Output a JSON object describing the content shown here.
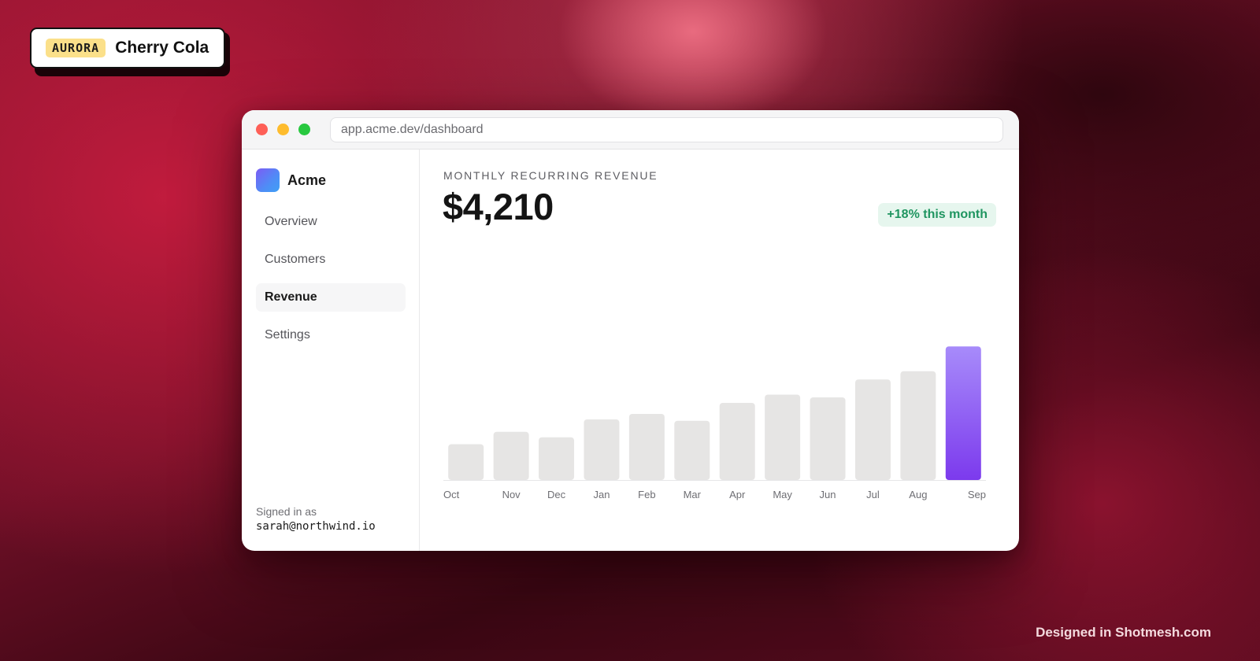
{
  "theme": {
    "badge": "AURORA",
    "name": "Cherry Cola"
  },
  "window": {
    "url": "app.acme.dev/dashboard"
  },
  "sidebar": {
    "brand": "Acme",
    "items": [
      {
        "label": "Overview",
        "active": false
      },
      {
        "label": "Customers",
        "active": false
      },
      {
        "label": "Revenue",
        "active": true
      },
      {
        "label": "Settings",
        "active": false
      }
    ],
    "signed_in_label": "Signed in as",
    "signed_in_email": "sarah@northwind.io"
  },
  "main": {
    "metric_label": "MONTHLY RECURRING REVENUE",
    "metric_value": "$4,210",
    "delta": "+18% this month"
  },
  "chart_data": {
    "type": "bar",
    "categories": [
      "Oct",
      "Nov",
      "Dec",
      "Jan",
      "Feb",
      "Mar",
      "Apr",
      "May",
      "Jun",
      "Jul",
      "Aug",
      "Sep"
    ],
    "values": [
      26,
      35,
      31,
      44,
      48,
      43,
      56,
      62,
      60,
      73,
      79,
      97
    ],
    "highlight_index": 11,
    "ylim": [
      0,
      100
    ],
    "colors": {
      "bar": "#e6e5e4",
      "highlight_top": "#a78bfa",
      "highlight_bottom": "#7c3aed",
      "axis": "#e6e6e8",
      "tick": "#6e6e73"
    }
  },
  "footer": {
    "credit": "Designed in Shotmesh.com"
  }
}
